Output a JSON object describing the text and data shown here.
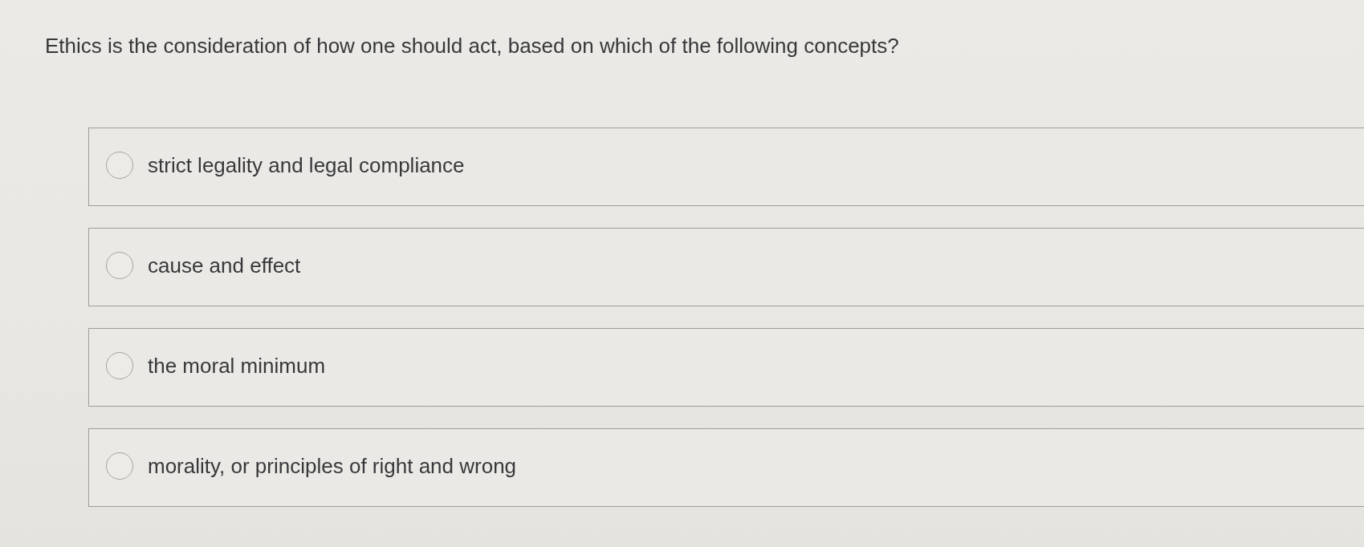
{
  "question": "Ethics is the consideration of how one should act, based on which of the following concepts?",
  "options": [
    {
      "label": "strict legality and legal compliance",
      "selected": false
    },
    {
      "label": "cause and effect",
      "selected": false
    },
    {
      "label": "the moral minimum",
      "selected": false
    },
    {
      "label": "morality, or principles of right and wrong",
      "selected": false
    }
  ]
}
